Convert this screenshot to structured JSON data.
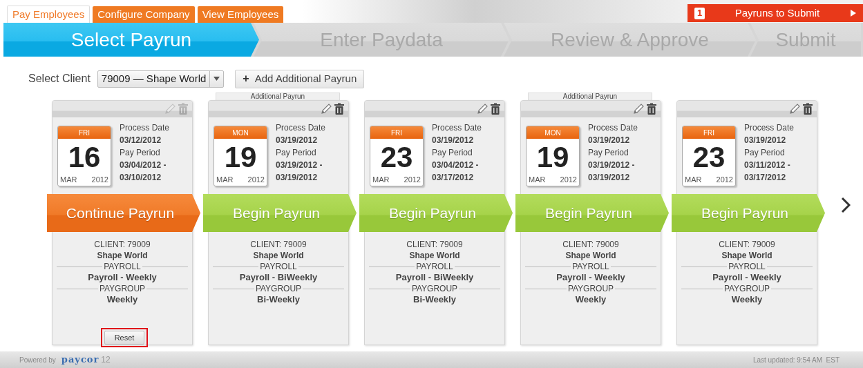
{
  "top_tabs": [
    {
      "label": "Pay Employees",
      "selected": true
    },
    {
      "label": "Configure Company",
      "selected": false
    },
    {
      "label": "View Employees",
      "selected": false
    }
  ],
  "submit_notice": {
    "count": "1",
    "label": "Payruns to Submit"
  },
  "steps": [
    {
      "label": "Select Payrun",
      "selected": true
    },
    {
      "label": "Enter Paydata",
      "selected": false
    },
    {
      "label": "Review & Approve",
      "selected": false
    },
    {
      "label": "Submit",
      "selected": false
    }
  ],
  "client_select": {
    "label": "Select Client",
    "value": "79009 — Shape World"
  },
  "add_button": {
    "icon": "+",
    "label": "Add Additional Payrun"
  },
  "cards": [
    {
      "icons_disabled": true,
      "weekday": "FRI",
      "day": "16",
      "month": "MAR",
      "year": "2012",
      "process_label": "Process Date",
      "process_date": "03/12/2012",
      "period_label": "Pay Period",
      "period_start": "03/04/2012 -",
      "period_end": "03/10/2012",
      "action": {
        "kind": "continue",
        "label": "Continue Payrun"
      },
      "client": "CLIENT: 79009",
      "client_name": "Shape World",
      "payroll_label": "PAYROLL",
      "payroll": "Payroll - Weekly",
      "paygroup_label": "PAYGROUP",
      "paygroup": "Weekly",
      "reset": {
        "label": "Reset",
        "highlighted": true
      }
    },
    {
      "tag": "Additional Payrun",
      "icons_disabled": false,
      "weekday": "MON",
      "day": "19",
      "month": "MAR",
      "year": "2012",
      "process_label": "Process Date",
      "process_date": "03/19/2012",
      "period_label": "Pay Period",
      "period_start": "03/19/2012 -",
      "period_end": "03/19/2012",
      "action": {
        "kind": "begin",
        "label": "Begin Payrun"
      },
      "client": "CLIENT: 79009",
      "client_name": "Shape World",
      "payroll_label": "PAYROLL",
      "payroll": "Payroll - BiWeekly",
      "paygroup_label": "PAYGROUP",
      "paygroup": "Bi-Weekly"
    },
    {
      "icons_disabled": false,
      "weekday": "FRI",
      "day": "23",
      "month": "MAR",
      "year": "2012",
      "process_label": "Process Date",
      "process_date": "03/19/2012",
      "period_label": "Pay Period",
      "period_start": "03/04/2012 -",
      "period_end": "03/17/2012",
      "action": {
        "kind": "begin",
        "label": "Begin Payrun"
      },
      "client": "CLIENT: 79009",
      "client_name": "Shape World",
      "payroll_label": "PAYROLL",
      "payroll": "Payroll - BiWeekly",
      "paygroup_label": "PAYGROUP",
      "paygroup": "Bi-Weekly"
    },
    {
      "tag": "Additional Payrun",
      "icons_disabled": false,
      "weekday": "MON",
      "day": "19",
      "month": "MAR",
      "year": "2012",
      "process_label": "Process Date",
      "process_date": "03/19/2012",
      "period_label": "Pay Period",
      "period_start": "03/19/2012 -",
      "period_end": "03/19/2012",
      "action": {
        "kind": "begin",
        "label": "Begin Payrun"
      },
      "client": "CLIENT: 79009",
      "client_name": "Shape World",
      "payroll_label": "PAYROLL",
      "payroll": "Payroll - Weekly",
      "paygroup_label": "PAYGROUP",
      "paygroup": "Weekly"
    },
    {
      "icons_disabled": false,
      "weekday": "FRI",
      "day": "23",
      "month": "MAR",
      "year": "2012",
      "process_label": "Process Date",
      "process_date": "03/19/2012",
      "period_label": "Pay Period",
      "period_start": "03/11/2012 -",
      "period_end": "03/17/2012",
      "action": {
        "kind": "begin",
        "label": "Begin Payrun"
      },
      "client": "CLIENT: 79009",
      "client_name": "Shape World",
      "payroll_label": "PAYROLL",
      "payroll": "Payroll - Weekly",
      "paygroup_label": "PAYGROUP",
      "paygroup": "Weekly"
    }
  ],
  "footer": {
    "powered": "Powered by",
    "brand": "paycor",
    "version": "12",
    "updated": "Last updated: 9:54 AM  EST"
  }
}
